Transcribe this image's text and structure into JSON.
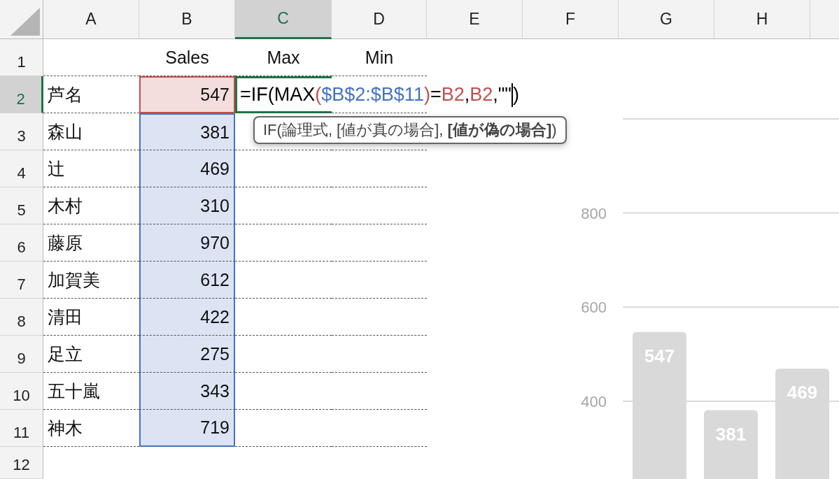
{
  "columns": [
    {
      "label": "A",
      "selected": false
    },
    {
      "label": "B",
      "selected": false
    },
    {
      "label": "C",
      "selected": true
    },
    {
      "label": "D",
      "selected": false
    },
    {
      "label": "E",
      "selected": false
    },
    {
      "label": "F",
      "selected": false
    },
    {
      "label": "G",
      "selected": false
    },
    {
      "label": "H",
      "selected": false
    }
  ],
  "header_row": {
    "number": "1",
    "selected": false,
    "sales": "Sales",
    "max": "Max",
    "min": "Min"
  },
  "rows": [
    {
      "number": "2",
      "selected": true,
      "name": "芦名",
      "sales": "547",
      "color": "#c0504d"
    },
    {
      "number": "3",
      "selected": false,
      "name": "森山",
      "sales": "381",
      "color": "#4472c4"
    },
    {
      "number": "4",
      "selected": false,
      "name": "辻",
      "sales": "469",
      "color": "#4472c4"
    },
    {
      "number": "5",
      "selected": false,
      "name": "木村",
      "sales": "310",
      "color": "#4472c4"
    },
    {
      "number": "6",
      "selected": false,
      "name": "藤原",
      "sales": "970",
      "color": "#4472c4"
    },
    {
      "number": "7",
      "selected": false,
      "name": "加賀美",
      "sales": "612",
      "color": "#4472c4"
    },
    {
      "number": "8",
      "selected": false,
      "name": "清田",
      "sales": "422",
      "color": "#4472c4"
    },
    {
      "number": "9",
      "selected": false,
      "name": "足立",
      "sales": "275",
      "color": "#4472c4"
    },
    {
      "number": "10",
      "selected": false,
      "name": "五十嵐",
      "sales": "343",
      "color": "#4472c4"
    },
    {
      "number": "11",
      "selected": false,
      "name": "神木",
      "sales": "719",
      "color": "#4472c4"
    }
  ],
  "empty_rows": [
    {
      "number": "12",
      "selected": false
    }
  ],
  "active_cell": {
    "formula": [
      {
        "text": "=IF(MAX",
        "color": "#000000"
      },
      {
        "text": "(",
        "color": "#c0504d"
      },
      {
        "text": "$B$2:$B$11",
        "color": "#4472c4"
      },
      {
        "text": ")",
        "color": "#c0504d"
      },
      {
        "text": "=",
        "color": "#000000"
      },
      {
        "text": "B2",
        "color": "#c0504d"
      },
      {
        "text": ",",
        "color": "#000000"
      },
      {
        "text": "B2",
        "color": "#c0504d"
      },
      {
        "text": ",\"\"",
        "color": "#000000"
      },
      {
        "text": ")",
        "color": "#000000",
        "cursor_before": true
      }
    ]
  },
  "tooltip": "IF(論理式, [値が真の場合], **[値が偽の場合]**)",
  "chart": {
    "chart_data": {
      "type": "bar",
      "values": [
        547,
        381,
        469
      ],
      "ylim": [
        0,
        1000
      ],
      "yticks": [
        400,
        600,
        800
      ],
      "data_labels": true,
      "grid": true
    }
  }
}
